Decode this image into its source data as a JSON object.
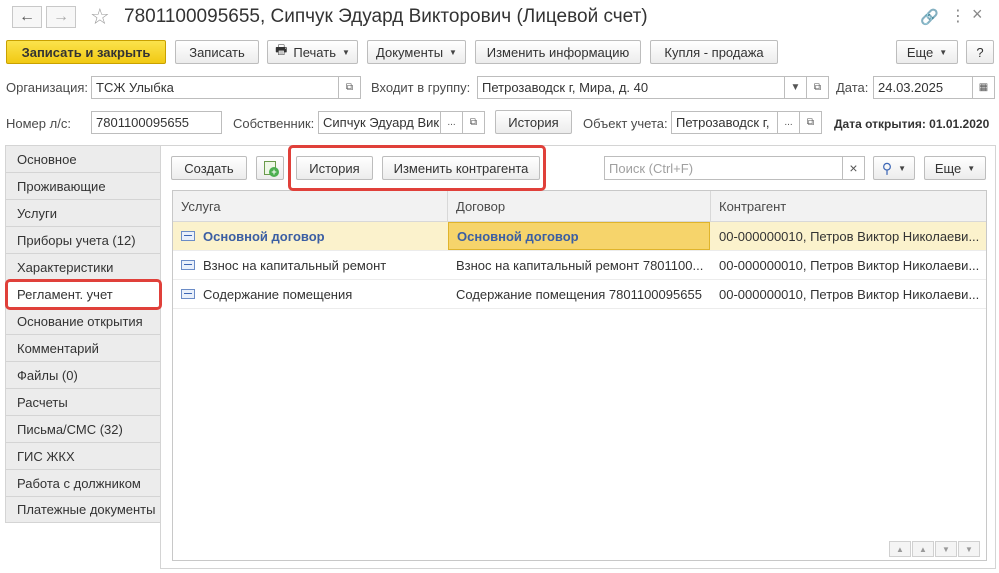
{
  "window": {
    "title": "7801100095655, Сипчук Эдуард Викторович (Лицевой счет)"
  },
  "toolbar": {
    "save_close": "Записать и закрыть",
    "save": "Записать",
    "print": "Печать",
    "documents": "Документы",
    "change_info": "Изменить информацию",
    "buy_sell": "Купля - продажа",
    "more": "Еще",
    "help": "?"
  },
  "form": {
    "org_label": "Организация:",
    "org_value": "ТСЖ Улыбка",
    "group_label": "Входит в группу:",
    "group_value": "Петрозаводск г, Мира, д. 40",
    "date_label": "Дата:",
    "date_value": "24.03.2025",
    "account_label": "Номер л/с:",
    "account_value": "7801100095655",
    "owner_label": "Собственник:",
    "owner_value": "Сипчук Эдуард Вик",
    "history_btn": "История",
    "object_label": "Объект учета:",
    "object_value": "Петрозаводск г,",
    "open_date": "Дата открытия: 01.01.2020"
  },
  "sidebar": {
    "items": [
      {
        "label": "Основное"
      },
      {
        "label": "Проживающие"
      },
      {
        "label": "Услуги"
      },
      {
        "label": "Приборы учета (12)"
      },
      {
        "label": "Характеристики"
      },
      {
        "label": "Регламент. учет"
      },
      {
        "label": "Основание открытия"
      },
      {
        "label": "Комментарий"
      },
      {
        "label": "Файлы (0)"
      },
      {
        "label": "Расчеты"
      },
      {
        "label": "Письма/СМС (32)"
      },
      {
        "label": "ГИС ЖКХ"
      },
      {
        "label": "Работа с должником"
      },
      {
        "label": "Платежные документы"
      }
    ],
    "active_index": 5
  },
  "panel": {
    "create": "Создать",
    "history": "История",
    "change_contractor": "Изменить контрагента",
    "search_placeholder": "Поиск (Ctrl+F)",
    "clear": "×",
    "more": "Еще"
  },
  "table": {
    "columns": [
      "Услуга",
      "Договор",
      "Контрагент"
    ],
    "rows": [
      {
        "service": "Основной договор",
        "contract": "Основной договор",
        "contractor": "00-000000010, Петров Виктор Николаеви..."
      },
      {
        "service": "Взнос на капитальный ремонт",
        "contract": "Взнос на капитальный ремонт 7801100...",
        "contractor": "00-000000010, Петров Виктор Николаеви..."
      },
      {
        "service": "Содержание помещения",
        "contract": "Содержание помещения 7801100095655",
        "contractor": "00-000000010, Петров Виктор Николаеви..."
      }
    ]
  },
  "colors": {
    "primary_button": "#f5d020",
    "selected_row": "#fbf2cc",
    "highlight": "#e0403a",
    "link_text": "#3b5ea3"
  }
}
